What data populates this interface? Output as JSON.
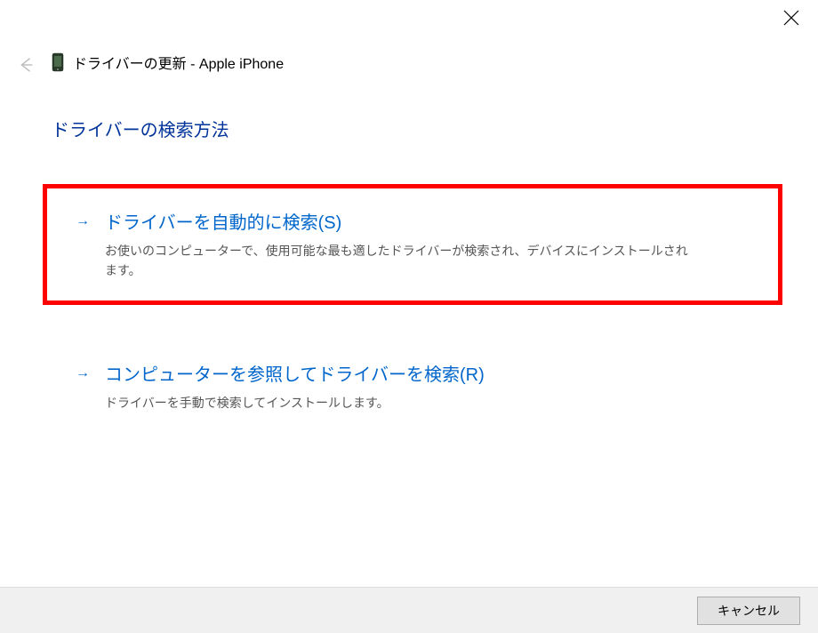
{
  "window": {
    "title": "ドライバーの更新 - Apple iPhone"
  },
  "content": {
    "instruction": "ドライバーの検索方法",
    "options": [
      {
        "title": "ドライバーを自動的に検索(S)",
        "description": "お使いのコンピューターで、使用可能な最も適したドライバーが検索され、デバイスにインストールされます。"
      },
      {
        "title": "コンピューターを参照してドライバーを検索(R)",
        "description": "ドライバーを手動で検索してインストールします。"
      }
    ]
  },
  "footer": {
    "cancel_label": "キャンセル"
  }
}
